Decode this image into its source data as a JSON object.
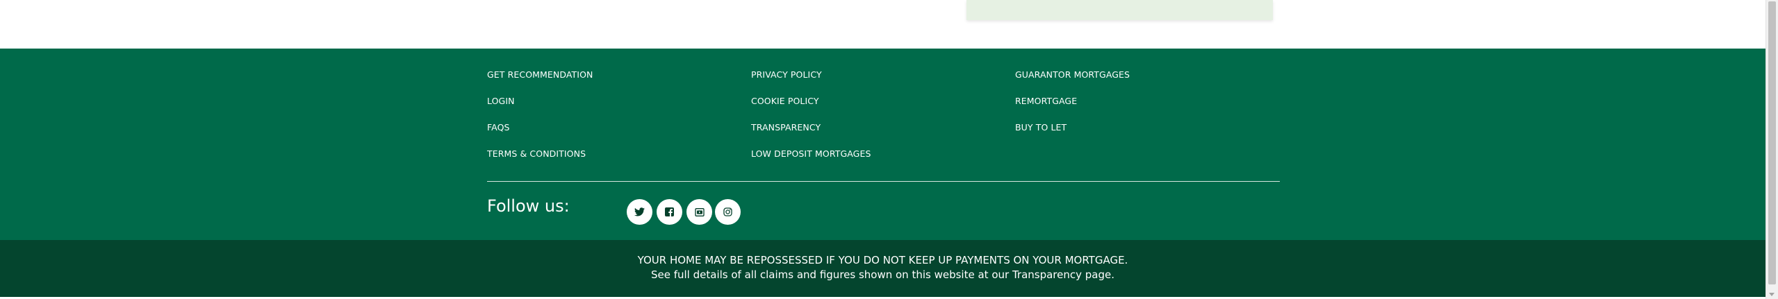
{
  "footer": {
    "col1": [
      "GET RECOMMENDATION",
      "LOGIN",
      "FAQS",
      "TERMS & CONDITIONS"
    ],
    "col2": [
      "PRIVACY POLICY",
      "COOKIE POLICY",
      "TRANSPARENCY",
      "LOW DEPOSIT MORTGAGES"
    ],
    "col3": [
      "GUARANTOR MORTGAGES",
      "REMORTGAGE",
      "BUY TO LET"
    ],
    "follow_label": "Follow us:",
    "social_icons": [
      "twitter-icon",
      "facebook-icon",
      "youtube-icon",
      "instagram-icon"
    ]
  },
  "disclaimer": {
    "line1": "YOUR HOME MAY BE REPOSSESSED IF YOU DO NOT KEEP UP PAYMENTS ON YOUR MORTGAGE.",
    "line2": "See full details of all claims and figures shown on this website at our Transparency page."
  },
  "colors": {
    "footer_main": "#006a4a",
    "footer_bottom": "#04452e",
    "card_bg": "#e6f1e3",
    "icon_color": "#05402b"
  }
}
